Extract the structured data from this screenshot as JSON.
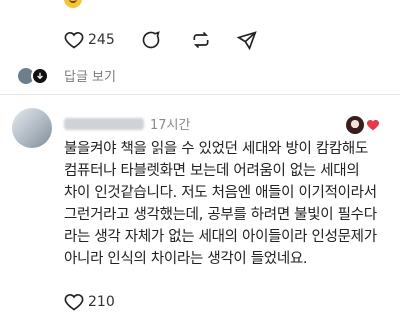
{
  "first_comment": {
    "emoji_icon": "grinning-face-emoji",
    "likes": "245",
    "actions": [
      "heart-icon",
      "comment-icon",
      "repost-icon",
      "share-icon"
    ],
    "view_replies": "답글 보기"
  },
  "second_comment": {
    "username": "",
    "time": "17시간",
    "body_lines": [
      "불을켜야 책을 읽을 수 있었던 세대와 방이 캄캄해도",
      "컴퓨터나 타블렛화면 보는데 어려움이 없는 세대의",
      "차이 인것같습니다. 저도 처음엔 애들이 이기적이라서",
      "그런거라고 생각했는데, 공부를 하려면 불빛이 필수다",
      "라는 생각 자체가 없는 세대의 아이들이라 인성문제가",
      "아니라 인식의 차이라는 생각이 들었네요."
    ],
    "likes": "210"
  },
  "colors": {
    "text": "#222222",
    "muted": "#8a8a8a",
    "divider": "#e6e6e6"
  }
}
